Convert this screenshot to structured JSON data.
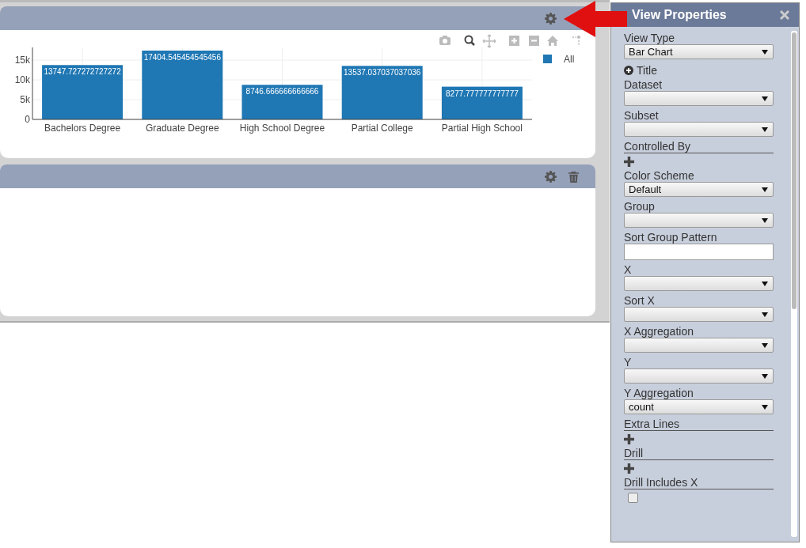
{
  "panels": [
    {
      "deletable": false,
      "chart_data": {
        "type": "bar",
        "categories": [
          "Bachelors Degree",
          "Graduate Degree",
          "High School Degree",
          "Partial College",
          "Partial High School"
        ],
        "series": [
          {
            "name": "All",
            "color": "#1f77b4",
            "values": [
              13748,
              17405,
              8747,
              13537,
              8278
            ]
          }
        ],
        "grid": true,
        "value_labels": [
          "13747.727272727272",
          "17404.545454545456",
          "8746.666666666666",
          "13537.037037037036",
          "8277.777777777777"
        ],
        "ylim": [
          0,
          18200
        ],
        "yticks": [
          {
            "value": 0,
            "label": "0"
          },
          {
            "value": 5000,
            "label": "5k"
          },
          {
            "value": 10000,
            "label": "10k"
          },
          {
            "value": 15000,
            "label": "15k"
          }
        ]
      }
    },
    {
      "deletable": true
    }
  ],
  "properties": {
    "title": "View Properties",
    "fields": [
      {
        "kind": "select",
        "label": "View Type",
        "value": "Bar Chart"
      },
      {
        "kind": "toggle",
        "label": "Title"
      },
      {
        "kind": "select",
        "label": "Dataset"
      },
      {
        "kind": "select",
        "label": "Subset"
      },
      {
        "kind": "add",
        "label": "Controlled By"
      },
      {
        "kind": "select",
        "label": "Color Scheme",
        "value": "Default"
      },
      {
        "kind": "select",
        "label": "Group"
      },
      {
        "kind": "input",
        "label": "Sort Group Pattern"
      },
      {
        "kind": "select",
        "label": "X"
      },
      {
        "kind": "select",
        "label": "Sort X"
      },
      {
        "kind": "select",
        "label": "X Aggregation"
      },
      {
        "kind": "select",
        "label": "Y"
      },
      {
        "kind": "select",
        "label": "Y Aggregation",
        "value": "count"
      },
      {
        "kind": "add",
        "label": "Extra Lines"
      },
      {
        "kind": "add",
        "label": "Drill"
      },
      {
        "kind": "checkbox",
        "label": "Drill Includes X",
        "checked": false
      }
    ]
  }
}
